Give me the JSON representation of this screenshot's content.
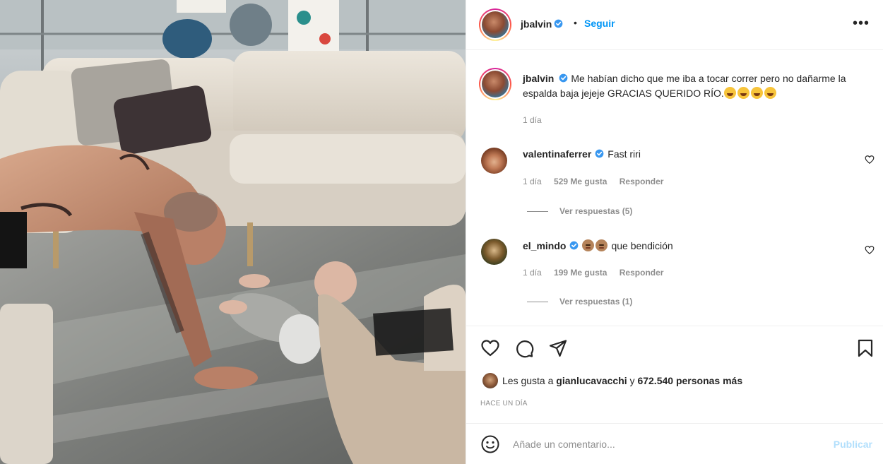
{
  "post": {
    "author": "jbalvin",
    "follow_label": "Seguir",
    "separator": "•",
    "more_label": "•••",
    "caption_text": "Me habían dicho que me iba a tocar correr pero no dañarme la espalda baja jejeje GRACIAS QUERIDO RÍO.",
    "caption_time": "1 día"
  },
  "comments": [
    {
      "username": "valentinaferrer",
      "text": "Fast riri",
      "time": "1 día",
      "likes": "529 Me gusta",
      "reply_label": "Responder",
      "view_replies": "Ver respuestas (5)"
    },
    {
      "username": "el_mindo",
      "text": "que bendición",
      "time": "1 día",
      "likes": "199 Me gusta",
      "reply_label": "Responder",
      "view_replies": "Ver respuestas (1)"
    }
  ],
  "likes_line": {
    "prefix": "Les gusta a ",
    "user": "gianlucavacchi",
    "connector": " y ",
    "count": "672.540 personas más"
  },
  "posted_ago": "HACE UN DÍA",
  "comment_box": {
    "placeholder": "Añade un comentario...",
    "publish_label": "Publicar"
  },
  "icons": [
    "heart-icon",
    "comment-icon",
    "share-icon",
    "bookmark-icon",
    "emoji-icon",
    "verified-icon",
    "more-icon"
  ],
  "colors": {
    "link": "#0095f6",
    "verified": "#3897f0",
    "muted": "#8e8e8e",
    "publish_disabled": "#b2dffc"
  }
}
